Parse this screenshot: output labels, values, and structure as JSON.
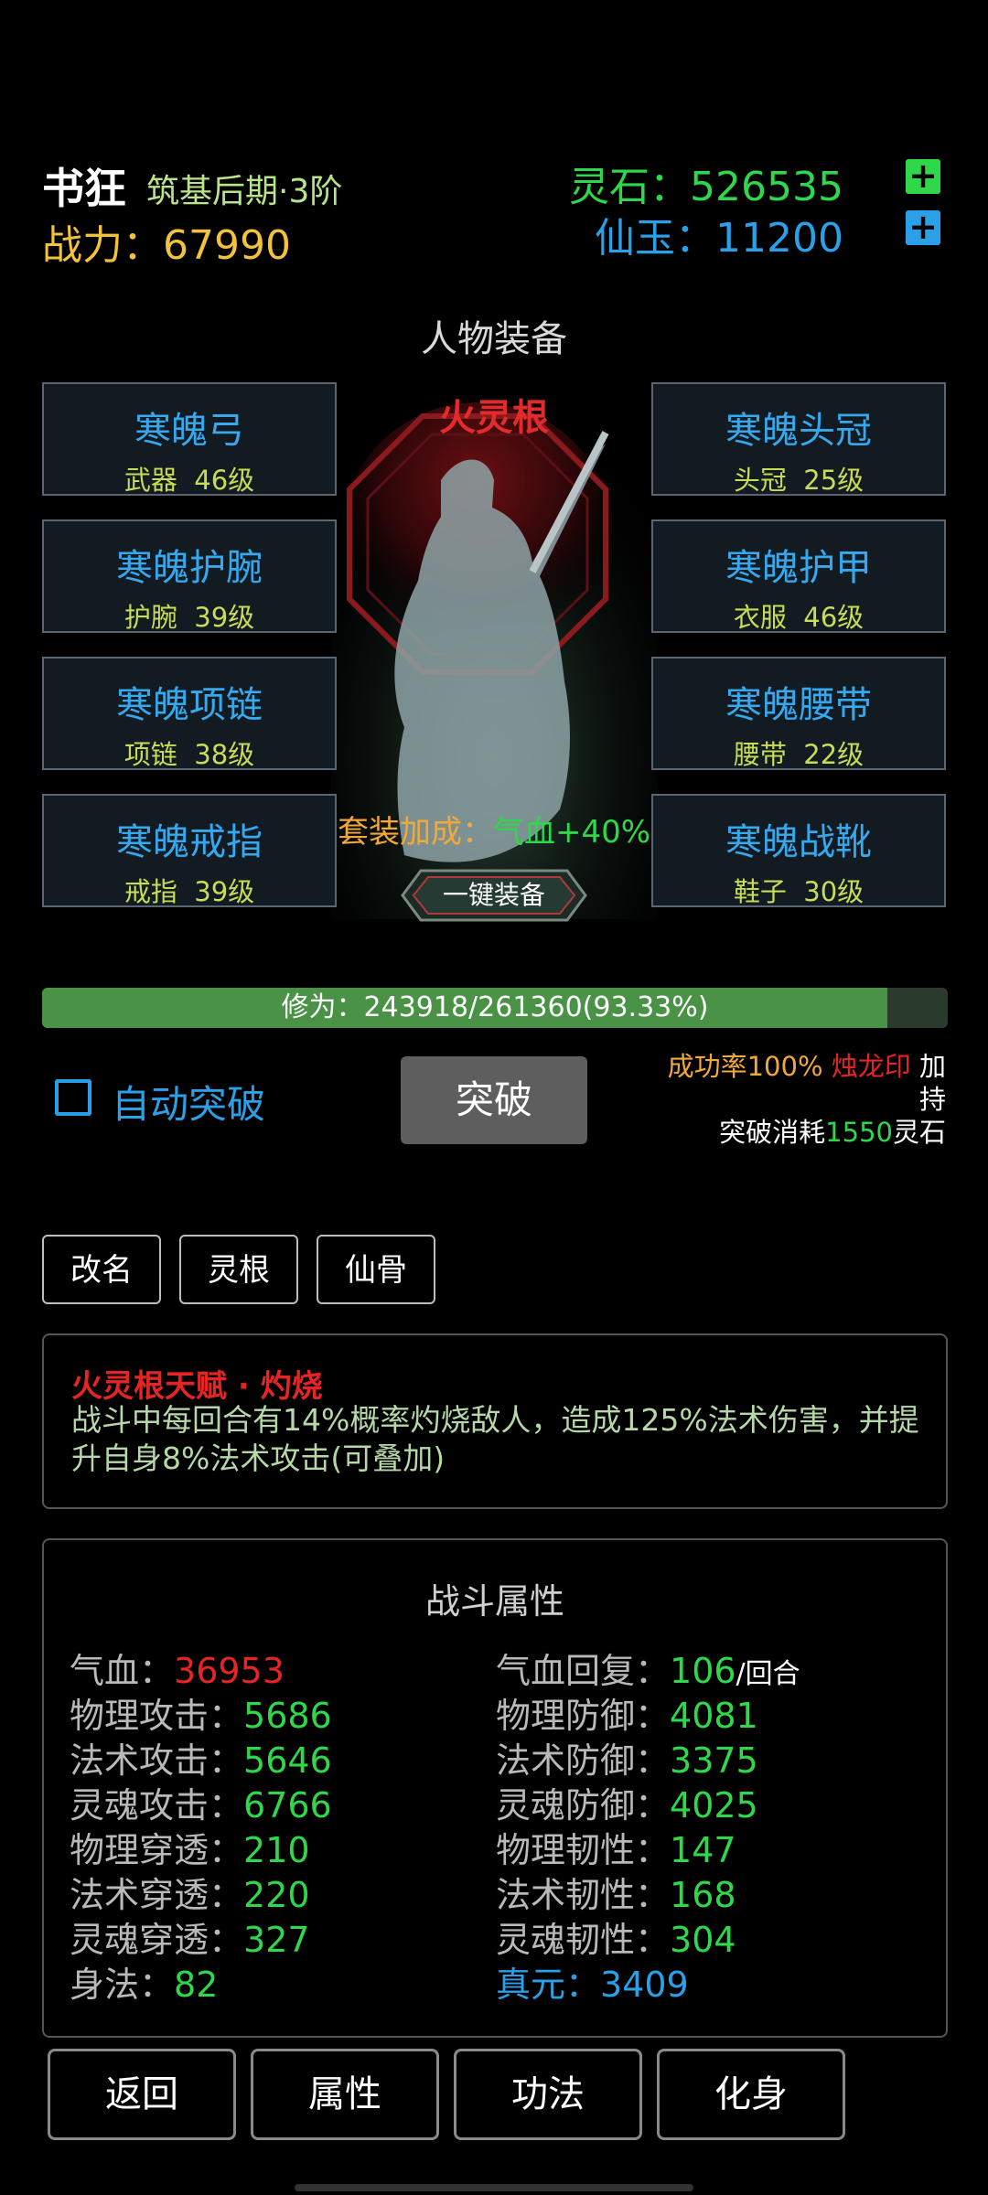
{
  "header": {
    "name": "书狂",
    "realm": "筑基后期·3阶",
    "power_label": "战力：",
    "power_value": "67990",
    "stone_label": "灵石：",
    "stone_value": "526535",
    "jade_label": "仙玉：",
    "jade_value": "11200",
    "plus": "+"
  },
  "equipment": {
    "title": "人物装备",
    "root_label": "火灵根",
    "left": [
      {
        "name": "寒魄弓",
        "slot": "武器",
        "level": "46级"
      },
      {
        "name": "寒魄护腕",
        "slot": "护腕",
        "level": "39级"
      },
      {
        "name": "寒魄项链",
        "slot": "项链",
        "level": "38级"
      },
      {
        "name": "寒魄戒指",
        "slot": "戒指",
        "level": "39级"
      }
    ],
    "right": [
      {
        "name": "寒魄头冠",
        "slot": "头冠",
        "level": "25级"
      },
      {
        "name": "寒魄护甲",
        "slot": "衣服",
        "level": "46级"
      },
      {
        "name": "寒魄腰带",
        "slot": "腰带",
        "level": "22级"
      },
      {
        "name": "寒魄战靴",
        "slot": "鞋子",
        "level": "30级"
      }
    ],
    "set_bonus_label": "套装加成：",
    "set_bonus_value": "气血+40%",
    "equip_all": "一键装备"
  },
  "cultivation": {
    "text": "修为：243918/261360(93.33%)",
    "progress": 0.9333,
    "auto_label": "自动突破",
    "break_label": "突破",
    "success": "成功率100%",
    "seal": "烛龙印",
    "bless_a": "加",
    "bless_b": "持",
    "cost_prefix": "突破消耗",
    "cost_value": "1550",
    "cost_suffix": "灵石"
  },
  "actions": [
    "改名",
    "灵根",
    "仙骨"
  ],
  "talent": {
    "title": "火灵根天赋 · 灼烧",
    "desc": "战斗中每回合有14%概率灼烧敌人，造成125%法术伤害，并提升自身8%法术攻击(可叠加)"
  },
  "stats": {
    "title": "战斗属性",
    "left": [
      {
        "label": "气血：",
        "value": "36953"
      },
      {
        "label": "物理攻击：",
        "value": "5686"
      },
      {
        "label": "法术攻击：",
        "value": "5646"
      },
      {
        "label": "灵魂攻击：",
        "value": "6766"
      },
      {
        "label": "物理穿透：",
        "value": "210"
      },
      {
        "label": "法术穿透：",
        "value": "220"
      },
      {
        "label": "灵魂穿透：",
        "value": "327"
      },
      {
        "label": "身法：",
        "value": "82"
      }
    ],
    "right": [
      {
        "label": "气血回复：",
        "value": "106",
        "unit": "/回合"
      },
      {
        "label": "物理防御：",
        "value": "4081"
      },
      {
        "label": "法术防御：",
        "value": "3375"
      },
      {
        "label": "灵魂防御：",
        "value": "4025"
      },
      {
        "label": "物理韧性：",
        "value": "147"
      },
      {
        "label": "法术韧性：",
        "value": "168"
      },
      {
        "label": "灵魂韧性：",
        "value": "304"
      },
      {
        "label": "真元：",
        "value": "3409"
      }
    ]
  },
  "nav": [
    "返回",
    "属性",
    "功法",
    "化身"
  ],
  "colors": {
    "hp_value": "#e62424",
    "stat_value": "#2fd84a",
    "zhenyuan": "#2aa0e8"
  }
}
